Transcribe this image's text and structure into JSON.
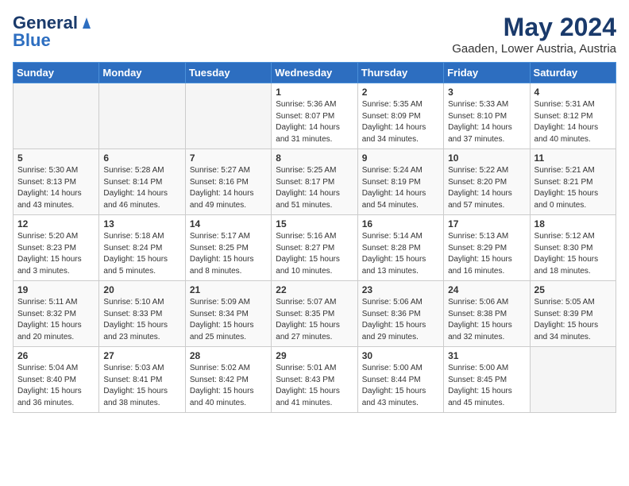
{
  "header": {
    "logo_line1": "General",
    "logo_line2": "Blue",
    "month_year": "May 2024",
    "location": "Gaaden, Lower Austria, Austria"
  },
  "weekdays": [
    "Sunday",
    "Monday",
    "Tuesday",
    "Wednesday",
    "Thursday",
    "Friday",
    "Saturday"
  ],
  "weeks": [
    [
      {
        "day": "",
        "sunrise": "",
        "sunset": "",
        "daylight": "",
        "empty": true
      },
      {
        "day": "",
        "sunrise": "",
        "sunset": "",
        "daylight": "",
        "empty": true
      },
      {
        "day": "",
        "sunrise": "",
        "sunset": "",
        "daylight": "",
        "empty": true
      },
      {
        "day": "1",
        "sunrise": "Sunrise: 5:36 AM",
        "sunset": "Sunset: 8:07 PM",
        "daylight": "Daylight: 14 hours and 31 minutes."
      },
      {
        "day": "2",
        "sunrise": "Sunrise: 5:35 AM",
        "sunset": "Sunset: 8:09 PM",
        "daylight": "Daylight: 14 hours and 34 minutes."
      },
      {
        "day": "3",
        "sunrise": "Sunrise: 5:33 AM",
        "sunset": "Sunset: 8:10 PM",
        "daylight": "Daylight: 14 hours and 37 minutes."
      },
      {
        "day": "4",
        "sunrise": "Sunrise: 5:31 AM",
        "sunset": "Sunset: 8:12 PM",
        "daylight": "Daylight: 14 hours and 40 minutes."
      }
    ],
    [
      {
        "day": "5",
        "sunrise": "Sunrise: 5:30 AM",
        "sunset": "Sunset: 8:13 PM",
        "daylight": "Daylight: 14 hours and 43 minutes."
      },
      {
        "day": "6",
        "sunrise": "Sunrise: 5:28 AM",
        "sunset": "Sunset: 8:14 PM",
        "daylight": "Daylight: 14 hours and 46 minutes."
      },
      {
        "day": "7",
        "sunrise": "Sunrise: 5:27 AM",
        "sunset": "Sunset: 8:16 PM",
        "daylight": "Daylight: 14 hours and 49 minutes."
      },
      {
        "day": "8",
        "sunrise": "Sunrise: 5:25 AM",
        "sunset": "Sunset: 8:17 PM",
        "daylight": "Daylight: 14 hours and 51 minutes."
      },
      {
        "day": "9",
        "sunrise": "Sunrise: 5:24 AM",
        "sunset": "Sunset: 8:19 PM",
        "daylight": "Daylight: 14 hours and 54 minutes."
      },
      {
        "day": "10",
        "sunrise": "Sunrise: 5:22 AM",
        "sunset": "Sunset: 8:20 PM",
        "daylight": "Daylight: 14 hours and 57 minutes."
      },
      {
        "day": "11",
        "sunrise": "Sunrise: 5:21 AM",
        "sunset": "Sunset: 8:21 PM",
        "daylight": "Daylight: 15 hours and 0 minutes."
      }
    ],
    [
      {
        "day": "12",
        "sunrise": "Sunrise: 5:20 AM",
        "sunset": "Sunset: 8:23 PM",
        "daylight": "Daylight: 15 hours and 3 minutes."
      },
      {
        "day": "13",
        "sunrise": "Sunrise: 5:18 AM",
        "sunset": "Sunset: 8:24 PM",
        "daylight": "Daylight: 15 hours and 5 minutes."
      },
      {
        "day": "14",
        "sunrise": "Sunrise: 5:17 AM",
        "sunset": "Sunset: 8:25 PM",
        "daylight": "Daylight: 15 hours and 8 minutes."
      },
      {
        "day": "15",
        "sunrise": "Sunrise: 5:16 AM",
        "sunset": "Sunset: 8:27 PM",
        "daylight": "Daylight: 15 hours and 10 minutes."
      },
      {
        "day": "16",
        "sunrise": "Sunrise: 5:14 AM",
        "sunset": "Sunset: 8:28 PM",
        "daylight": "Daylight: 15 hours and 13 minutes."
      },
      {
        "day": "17",
        "sunrise": "Sunrise: 5:13 AM",
        "sunset": "Sunset: 8:29 PM",
        "daylight": "Daylight: 15 hours and 16 minutes."
      },
      {
        "day": "18",
        "sunrise": "Sunrise: 5:12 AM",
        "sunset": "Sunset: 8:30 PM",
        "daylight": "Daylight: 15 hours and 18 minutes."
      }
    ],
    [
      {
        "day": "19",
        "sunrise": "Sunrise: 5:11 AM",
        "sunset": "Sunset: 8:32 PM",
        "daylight": "Daylight: 15 hours and 20 minutes."
      },
      {
        "day": "20",
        "sunrise": "Sunrise: 5:10 AM",
        "sunset": "Sunset: 8:33 PM",
        "daylight": "Daylight: 15 hours and 23 minutes."
      },
      {
        "day": "21",
        "sunrise": "Sunrise: 5:09 AM",
        "sunset": "Sunset: 8:34 PM",
        "daylight": "Daylight: 15 hours and 25 minutes."
      },
      {
        "day": "22",
        "sunrise": "Sunrise: 5:07 AM",
        "sunset": "Sunset: 8:35 PM",
        "daylight": "Daylight: 15 hours and 27 minutes."
      },
      {
        "day": "23",
        "sunrise": "Sunrise: 5:06 AM",
        "sunset": "Sunset: 8:36 PM",
        "daylight": "Daylight: 15 hours and 29 minutes."
      },
      {
        "day": "24",
        "sunrise": "Sunrise: 5:06 AM",
        "sunset": "Sunset: 8:38 PM",
        "daylight": "Daylight: 15 hours and 32 minutes."
      },
      {
        "day": "25",
        "sunrise": "Sunrise: 5:05 AM",
        "sunset": "Sunset: 8:39 PM",
        "daylight": "Daylight: 15 hours and 34 minutes."
      }
    ],
    [
      {
        "day": "26",
        "sunrise": "Sunrise: 5:04 AM",
        "sunset": "Sunset: 8:40 PM",
        "daylight": "Daylight: 15 hours and 36 minutes."
      },
      {
        "day": "27",
        "sunrise": "Sunrise: 5:03 AM",
        "sunset": "Sunset: 8:41 PM",
        "daylight": "Daylight: 15 hours and 38 minutes."
      },
      {
        "day": "28",
        "sunrise": "Sunrise: 5:02 AM",
        "sunset": "Sunset: 8:42 PM",
        "daylight": "Daylight: 15 hours and 40 minutes."
      },
      {
        "day": "29",
        "sunrise": "Sunrise: 5:01 AM",
        "sunset": "Sunset: 8:43 PM",
        "daylight": "Daylight: 15 hours and 41 minutes."
      },
      {
        "day": "30",
        "sunrise": "Sunrise: 5:00 AM",
        "sunset": "Sunset: 8:44 PM",
        "daylight": "Daylight: 15 hours and 43 minutes."
      },
      {
        "day": "31",
        "sunrise": "Sunrise: 5:00 AM",
        "sunset": "Sunset: 8:45 PM",
        "daylight": "Daylight: 15 hours and 45 minutes."
      },
      {
        "day": "",
        "sunrise": "",
        "sunset": "",
        "daylight": "",
        "empty": true
      }
    ]
  ]
}
